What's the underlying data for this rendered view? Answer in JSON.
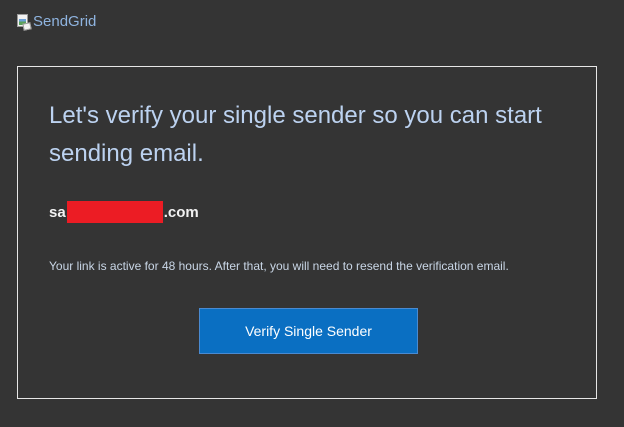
{
  "logo": {
    "alt_text": "SendGrid",
    "icon": "broken-image-icon"
  },
  "card": {
    "headline": "Let's verify your single sender so you can start sending email.",
    "email_prefix": "sa",
    "email_suffix": ".com",
    "note": "Your link is active for 48 hours. After that, you will need to resend the verification email.",
    "button_label": "Verify Single Sender"
  },
  "colors": {
    "background": "#343434",
    "headline": "#bcd2f0",
    "button": "#0a6fc2",
    "redaction": "#ec1c24"
  }
}
